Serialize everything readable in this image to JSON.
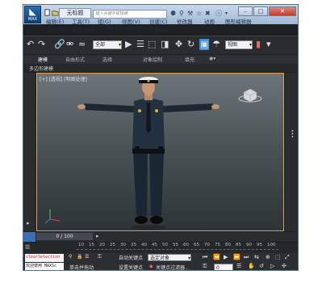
{
  "app": {
    "logo": "MAX",
    "document_title": "无标题",
    "search_placeholder": "键入关键字或短语"
  },
  "menus": [
    {
      "label": "编辑(E)"
    },
    {
      "label": "工具(T)"
    },
    {
      "label": "组(G)"
    },
    {
      "label": "视图(V)"
    },
    {
      "label": "创建(C)"
    },
    {
      "label": "修改器"
    },
    {
      "label": "动画"
    },
    {
      "label": "图形编辑器"
    },
    {
      "label": "渲染(R)"
    },
    {
      "label": "自定义(U)"
    },
    {
      "label": "MAXScript(M)"
    },
    {
      "label": "帮助(H)"
    }
  ],
  "toolbar": {
    "selection_filter": "全部",
    "ref_coord": "视图"
  },
  "ribbon": {
    "tabs": [
      "建模",
      "自由形式",
      "选择",
      "对象绘制",
      "填充"
    ],
    "active_tab": 0
  },
  "subpanel": {
    "label": "多边形建模"
  },
  "viewport": {
    "label": "[+] [透视] [明暗处理]"
  },
  "timeline": {
    "frame_label": "0 / 100",
    "ticks": [
      "10",
      "15",
      "20",
      "25",
      "30",
      "35",
      "40",
      "45",
      "50",
      "55",
      "60",
      "65",
      "70",
      "75",
      "80",
      "85",
      "90",
      "95",
      "100"
    ]
  },
  "status": {
    "maxscript_top": "clearSelection",
    "maxscript_bottom": "欢迎使用 MAXSc",
    "hint": "单击并拖动",
    "auto_key": "自动关键点",
    "set_key": "设置关键点",
    "selected_object": "选定对象",
    "key_filters": "关键点过滤器...",
    "frame_value": "0"
  },
  "colors": {
    "viewport_border": "#d7a74a",
    "title_gradient_top": "#c9d9ec",
    "app_logo": "#1a5a97"
  }
}
